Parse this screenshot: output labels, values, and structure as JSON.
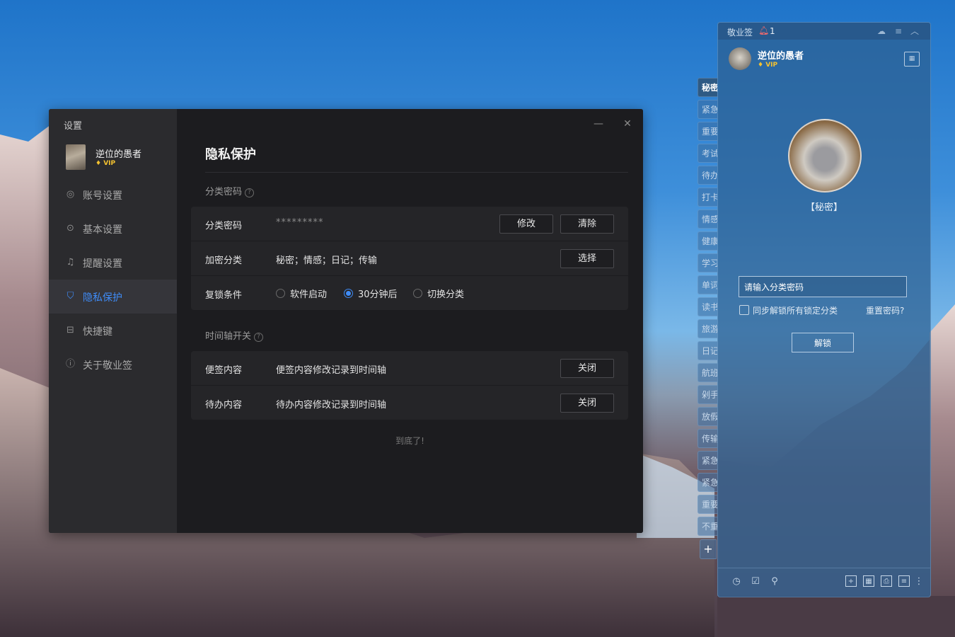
{
  "settings": {
    "window_title": "设置",
    "user": {
      "name": "逆位的愚者",
      "vip": "VIP"
    },
    "nav": [
      {
        "label": "账号设置",
        "icon": "user-circle-icon"
      },
      {
        "label": "基本设置",
        "icon": "settings-dot-icon"
      },
      {
        "label": "提醒设置",
        "icon": "bell-icon"
      },
      {
        "label": "隐私保护",
        "icon": "shield-icon"
      },
      {
        "label": "快捷键",
        "icon": "keyboard-icon"
      },
      {
        "label": "关于敬业签",
        "icon": "info-icon"
      }
    ],
    "minimize": "—",
    "close": "✕",
    "page_title": "隐私保护",
    "section1": {
      "title": "分类密码",
      "help": "?"
    },
    "rows1": {
      "password": {
        "label": "分类密码",
        "value": "*********",
        "btn_modify": "修改",
        "btn_clear": "清除"
      },
      "encrypted": {
        "label": "加密分类",
        "value": "秘密；情感；日记；传输",
        "btn_select": "选择"
      },
      "relock": {
        "label": "复锁条件",
        "options": [
          "软件启动",
          "30分钟后",
          "切换分类"
        ],
        "selected": "30分钟后"
      }
    },
    "section2": {
      "title": "时间轴开关",
      "help": "?"
    },
    "rows2": {
      "note": {
        "label": "便签内容",
        "desc": "便签内容修改记录到时间轴",
        "btn": "关闭"
      },
      "todo": {
        "label": "待办内容",
        "desc": "待办内容修改记录到时间轴",
        "btn": "关闭"
      }
    },
    "end_text": "到底了!"
  },
  "panel": {
    "app_title": "敬业签",
    "notification_count": "1",
    "user": {
      "name": "逆位的愚者",
      "vip": "VIP"
    },
    "locked_category": "【秘密】",
    "password_placeholder": "请输入分类密码",
    "sync_unlock": "同步解锁所有锁定分类",
    "reset_password": "重置密码?",
    "unlock_button": "解锁",
    "tabs": [
      "秘密",
      "紧急",
      "重要",
      "考试",
      "待办",
      "打卡",
      "情感",
      "健康",
      "学习",
      "单词",
      "读书",
      "旅游",
      "日记",
      "航班",
      "剁手",
      "放假",
      "传输",
      "紧急",
      "紧急",
      "重要",
      "不重"
    ],
    "add_tab": "+",
    "bottom_icons": [
      "clock-icon",
      "checkbox-icon",
      "search-icon",
      "add-note-icon",
      "grid-icon",
      "print-icon",
      "calc-icon",
      "more-icon"
    ]
  }
}
